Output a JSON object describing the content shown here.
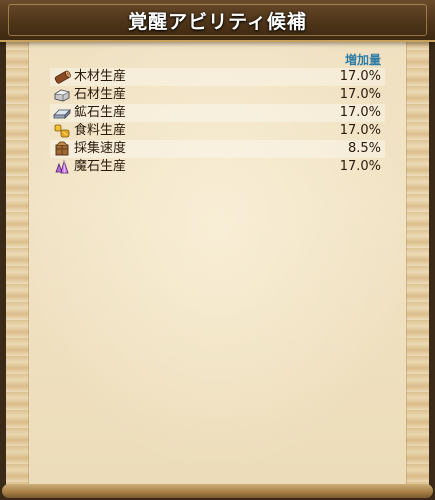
{
  "title": "覚醒アビリティ候補",
  "column_header": "増加量",
  "rows": [
    {
      "icon": "wood-log-icon",
      "label": "木材生産",
      "value": "17.0%"
    },
    {
      "icon": "stone-block-icon",
      "label": "石材生産",
      "value": "17.0%"
    },
    {
      "icon": "ore-ingot-icon",
      "label": "鉱石生産",
      "value": "17.0%"
    },
    {
      "icon": "food-bread-icon",
      "label": "食料生産",
      "value": "17.0%"
    },
    {
      "icon": "gathering-crate-icon",
      "label": "採集速度",
      "value": "8.5%"
    },
    {
      "icon": "magic-crystal-icon",
      "label": "魔石生産",
      "value": "17.0%"
    }
  ]
}
